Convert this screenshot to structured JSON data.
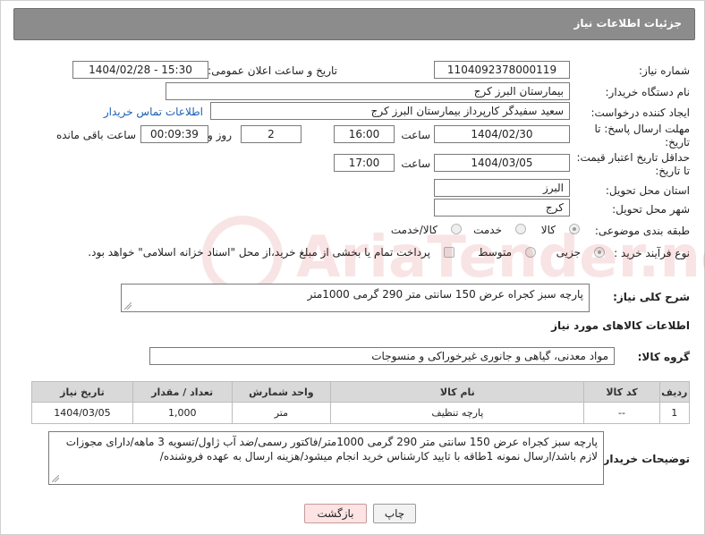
{
  "header": {
    "title": "جزئیات اطلاعات نیاز"
  },
  "fields": {
    "need_number_label": "شماره نیاز:",
    "need_number": "1104092378000119",
    "announce_label": "تاریخ و ساعت اعلان عمومی:",
    "announce_value": "1404/02/28 - 15:30",
    "buyer_org_label": "نام دستگاه خریدار:",
    "buyer_org": "بیمارستان البرز کرج",
    "requester_label": "ایجاد کننده درخواست:",
    "requester": "سعید سفیدگر کارپرداز بیمارستان البرز کرج",
    "contact_link": "اطلاعات تماس خریدار",
    "deadline_label_1": "مهلت ارسال پاسخ: تا",
    "deadline_label_2": "تاریخ:",
    "deadline_date": "1404/02/30",
    "time_label": "ساعت",
    "deadline_time": "16:00",
    "days_value": "2",
    "days_label": "روز و",
    "remaining_value": "00:09:39",
    "remaining_label": "ساعت باقی مانده",
    "price_validity_label_1": "حداقل تاریخ اعتبار قیمت:",
    "price_validity_label_2": "تا تاریخ:",
    "price_validity_date": "1404/03/05",
    "price_validity_time": "17:00",
    "province_label": "استان محل تحویل:",
    "province": "البرز",
    "city_label": "شهر محل تحویل:",
    "city": "کرج",
    "category_label": "طبقه بندی موضوعی:",
    "category_options": [
      "کالا",
      "خدمت",
      "کالا/خدمت"
    ],
    "process_label": "نوع فرآیند خرید :",
    "process_options": [
      "جزیی",
      "متوسط"
    ],
    "payment_note": "پرداخت تمام یا بخشی از مبلغ خرید،از محل \"اسناد خزانه اسلامی\" خواهد بود."
  },
  "description": {
    "label": "شرح کلی نیاز:",
    "text": "پارچه سبز کجراه عرض 150 سانتی متر 290 گرمی 1000متر"
  },
  "goods": {
    "section_title": "اطلاعات کالاهای مورد نیاز",
    "group_label": "گروه کالا:",
    "group_value": "مواد معدنی، گیاهی و جانوری غیرخوراکی و منسوجات",
    "columns": [
      "ردیف",
      "کد کالا",
      "نام کالا",
      "واحد شمارش",
      "تعداد / مقدار",
      "تاریخ نیاز"
    ],
    "rows": [
      [
        "1",
        "--",
        "پارچه تنظیف",
        "متر",
        "1,000",
        "1404/03/05"
      ]
    ]
  },
  "buyer_notes": {
    "label": "توضیحات خریدار:",
    "text": "پارچه سبز کجراه عرض 150 سانتی متر 290 گرمی 1000متر/فاکتور رسمی/ضد آب ژاول/تسویه 3 ماهه/دارای مجوزات لازم باشد/ارسال نمونه 1طاقه با تایید کارشناس خرید انجام میشود/هزینه ارسال به عهده فروشنده/"
  },
  "buttons": {
    "print": "چاپ",
    "back": "بازگشت"
  },
  "watermark": "AriaTender.net"
}
